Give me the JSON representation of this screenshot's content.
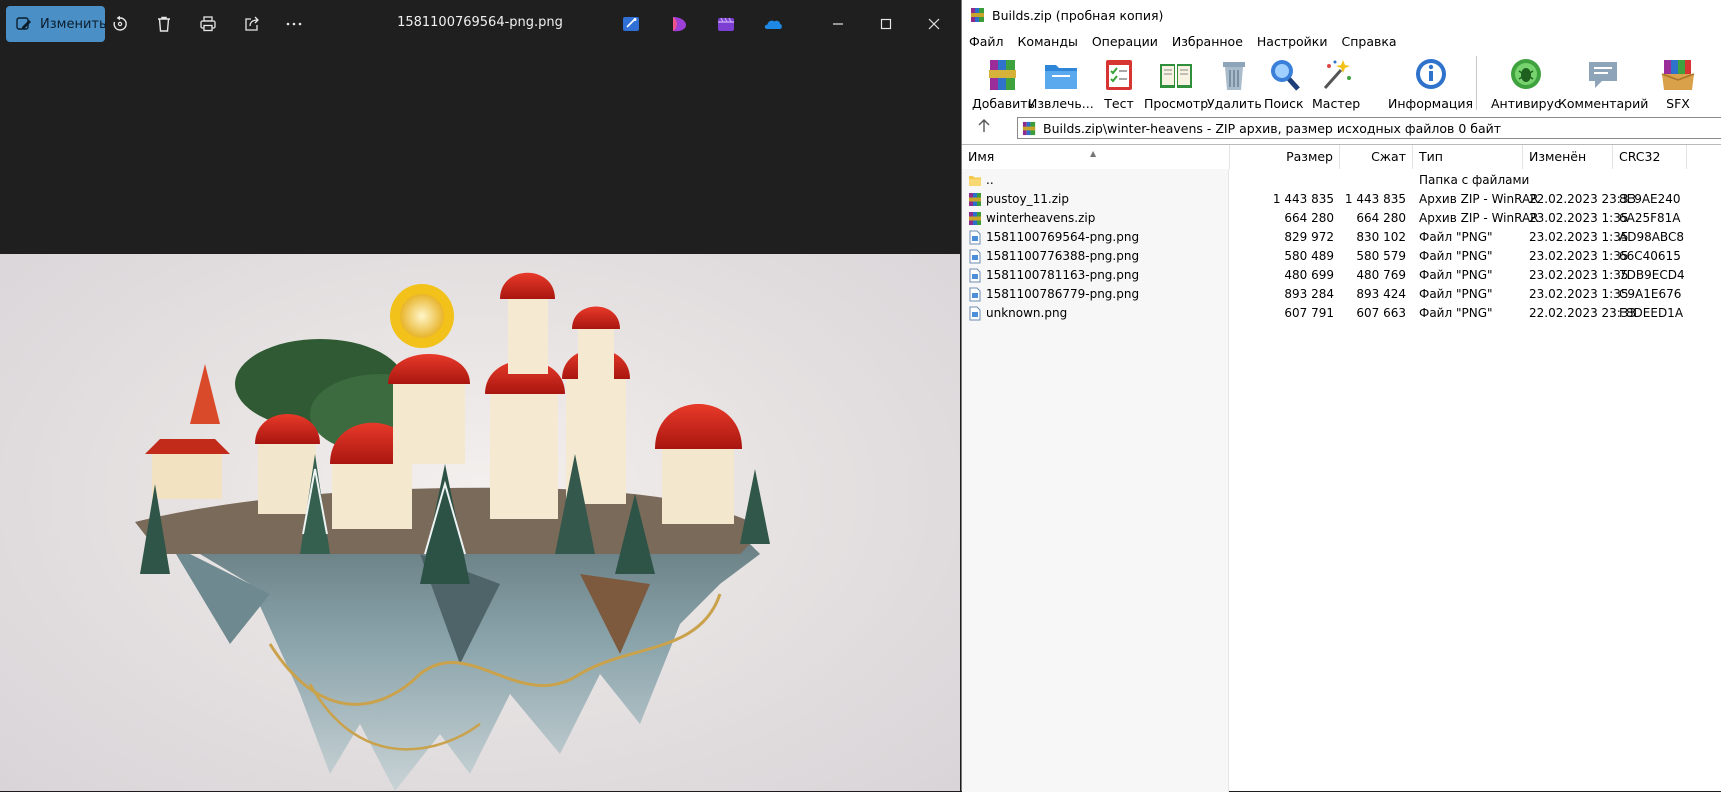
{
  "viewer": {
    "edit_label": "Изменить",
    "filename": "1581100769564-png.png",
    "toolbar_icons": [
      "rotate-icon",
      "delete-icon",
      "print-icon",
      "share-icon",
      "more-icon"
    ],
    "app_icons": [
      "designer-icon",
      "clipchamp-like-icon",
      "video-editor-icon",
      "onedrive-icon"
    ],
    "accent_color": "#4a90c7"
  },
  "rar": {
    "title": "Builds.zip (пробная копия)",
    "menu": [
      "Файл",
      "Команды",
      "Операции",
      "Избранное",
      "Настройки",
      "Справка"
    ],
    "toolbar": [
      {
        "label": "Добавить",
        "icon": "add-archive-icon"
      },
      {
        "label": "Извлечь...",
        "icon": "extract-folder-icon"
      },
      {
        "label": "Тест",
        "icon": "test-checklist-icon"
      },
      {
        "label": "Просмотр",
        "icon": "view-book-icon"
      },
      {
        "label": "Удалить",
        "icon": "trash-can-icon"
      },
      {
        "label": "Поиск",
        "icon": "search-magnifier-icon"
      },
      {
        "label": "Мастер",
        "icon": "wizard-wand-icon"
      },
      {
        "label": "Информация",
        "icon": "info-icon"
      },
      {
        "label": "Антивирус",
        "icon": "antivirus-bug-icon"
      },
      {
        "label": "Комментарий",
        "icon": "comment-icon"
      },
      {
        "label": "SFX",
        "icon": "sfx-box-icon"
      }
    ],
    "path": "Builds.zip\\winter-heavens - ZIP архив, размер исходных файлов 0 байт",
    "columns": {
      "name": "Имя",
      "size": "Размер",
      "packed": "Сжат",
      "type": "Тип",
      "modified": "Изменён",
      "crc": "CRC32"
    },
    "files": [
      {
        "name": "..",
        "size": "",
        "packed": "",
        "type": "Папка с файлами",
        "modified": "",
        "crc": "",
        "icon": "folder-icon"
      },
      {
        "name": "pustoy_11.zip",
        "size": "1 443 835",
        "packed": "1 443 835",
        "type": "Архив ZIP - WinRAR",
        "modified": "22.02.2023 23:33",
        "crc": "8E9AE240",
        "icon": "winrar-archive-icon"
      },
      {
        "name": "winterheavens.zip",
        "size": "664 280",
        "packed": "664 280",
        "type": "Архив ZIP - WinRAR",
        "modified": "23.02.2023 1:35",
        "crc": "6A25F81A",
        "icon": "winrar-archive-icon"
      },
      {
        "name": "1581100769564-png.png",
        "size": "829 972",
        "packed": "830 102",
        "type": "Файл \"PNG\"",
        "modified": "23.02.2023 1:35",
        "crc": "AD98ABC8",
        "icon": "png-file-icon"
      },
      {
        "name": "1581100776388-png.png",
        "size": "580 489",
        "packed": "580 579",
        "type": "Файл \"PNG\"",
        "modified": "23.02.2023 1:35",
        "crc": "66C40615",
        "icon": "png-file-icon"
      },
      {
        "name": "1581100781163-png.png",
        "size": "480 699",
        "packed": "480 769",
        "type": "Файл \"PNG\"",
        "modified": "23.02.2023 1:35",
        "crc": "7DB9ECD4",
        "icon": "png-file-icon"
      },
      {
        "name": "1581100786779-png.png",
        "size": "893 284",
        "packed": "893 424",
        "type": "Файл \"PNG\"",
        "modified": "23.02.2023 1:35",
        "crc": "C9A1E676",
        "icon": "png-file-icon"
      },
      {
        "name": "unknown.png",
        "size": "607 791",
        "packed": "607 663",
        "type": "Файл \"PNG\"",
        "modified": "22.02.2023 23:33",
        "crc": "F8DEED1A",
        "icon": "png-file-icon"
      }
    ]
  }
}
